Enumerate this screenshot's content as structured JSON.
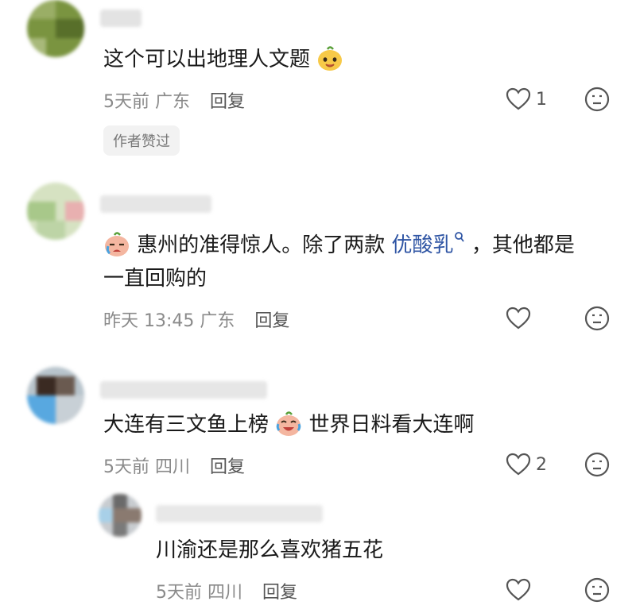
{
  "comments": [
    {
      "text": "这个可以出地理人文题",
      "emoji": "smiling-face-emoji",
      "time": "5天前",
      "location": "广东",
      "reply_label": "回复",
      "likes": "1",
      "badge": "作者赞过"
    },
    {
      "text_line1": "惠州的准得惊人。除了两款",
      "link": "优酸乳",
      "text_line1_end": "，其他都是",
      "text_line2": "一直回购的",
      "emoji": "crying-face-emoji",
      "time": "昨天 13:45",
      "location": "广东",
      "reply_label": "回复",
      "likes": ""
    },
    {
      "text_before": "大连有三文鱼上榜",
      "text_after": "世界日料看大连啊",
      "emoji": "laughing-tears-face-emoji",
      "time": "5天前",
      "location": "四川",
      "reply_label": "回复",
      "likes": "2"
    },
    {
      "text": "川渝还是那么喜欢猪五花",
      "time": "5天前",
      "location": "四川",
      "reply_label": "回复",
      "likes": ""
    }
  ]
}
